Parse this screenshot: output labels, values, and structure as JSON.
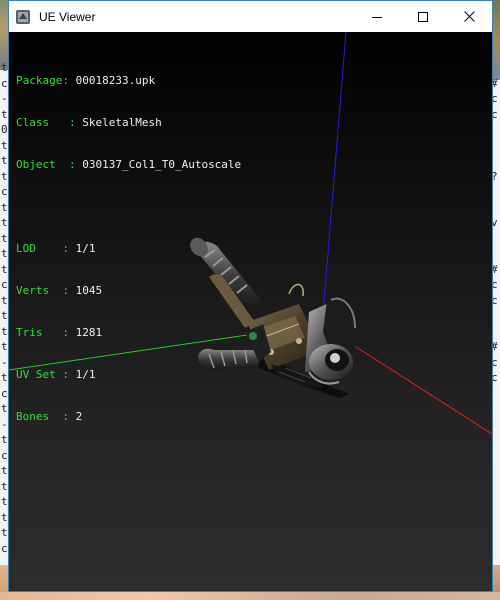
{
  "window": {
    "title": "UE Viewer",
    "controls": [
      "minimize",
      "maximize",
      "close"
    ]
  },
  "info_block_1": [
    {
      "key": "Package: ",
      "value": "00018233.upk"
    },
    {
      "key": "Class   : ",
      "value": "SkeletalMesh"
    },
    {
      "key": "Object  : ",
      "value": "030137_Col1_T0_Autoscale"
    }
  ],
  "info_block_2": [
    {
      "key": "LOD    : ",
      "value": "1/1"
    },
    {
      "key": "Verts  : ",
      "value": "1045"
    },
    {
      "key": "Tris   : ",
      "value": "1281"
    },
    {
      "key": "UV Set : ",
      "value": "1/1"
    },
    {
      "key": "Bones  : ",
      "value": "2"
    }
  ],
  "axes": {
    "x_color": "#e02020",
    "y_color": "#22cc22",
    "z_color": "#2222dd"
  },
  "background_console": {
    "left_chars": "t\nc\n-\nt\n0\nt\nt\nt\nc\nt\nt\nt\nt\nt\nc\nt\nt\nt\nt\n-\nt\nc\nt\n-\nt\nc\nt\nt\nt\nt\nt\nc",
    "right_chars": "\n#\nc\nc\n\n\n\n?\n\n\nv\n\n\n#\nc\nc\n\n\n#\nc\nc\n\n\n\n"
  },
  "icons": {
    "app": "ue-viewer-app-icon",
    "minimize": "minimize-icon",
    "maximize": "maximize-icon",
    "close": "close-icon"
  }
}
